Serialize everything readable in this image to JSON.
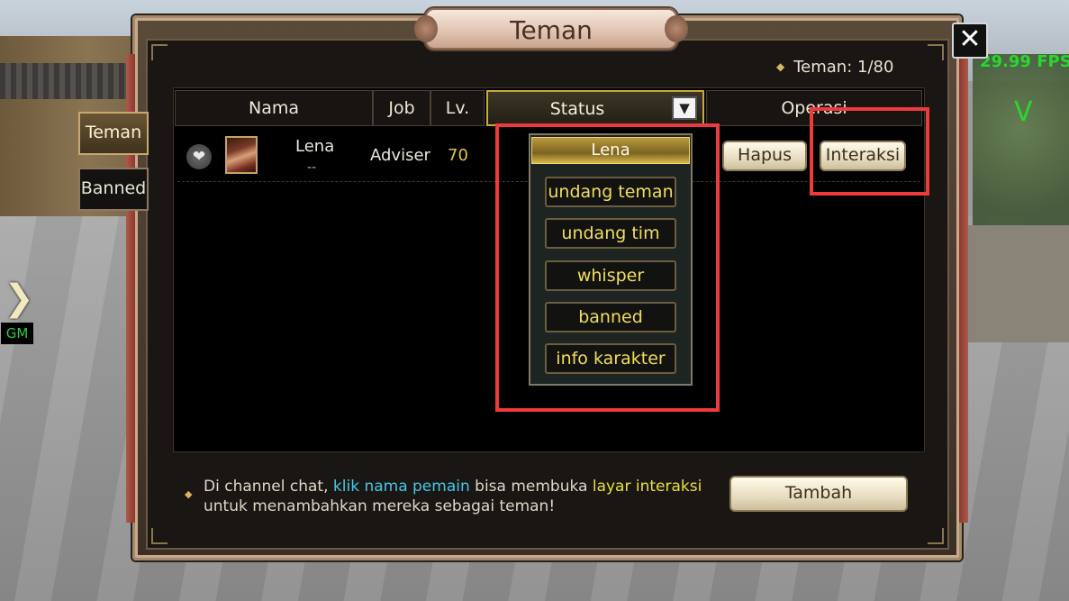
{
  "window": {
    "title": "Teman",
    "close_glyph": "✕"
  },
  "hud": {
    "fps": "29.99 FPS",
    "gm_label": "GM",
    "gm_arrow": "❯",
    "v_mark": "V"
  },
  "counter": {
    "label": "Teman: 1/80"
  },
  "side_tabs": [
    {
      "label": "Teman",
      "active": true
    },
    {
      "label": "Banned",
      "active": false
    }
  ],
  "table": {
    "headers": {
      "name": "Nama",
      "job": "Job",
      "level": "Lv.",
      "status": "Status",
      "operation": "Operasi"
    },
    "dropdown_glyph": "▼",
    "row": {
      "heart_glyph": "❤",
      "name": "Lena",
      "name_sub": "--",
      "job": "Adviser",
      "level": "70",
      "buttons": {
        "delete": "Hapus",
        "interact": "Interaksi"
      }
    }
  },
  "menu": {
    "title": "Lena",
    "items": [
      "undang teman",
      "undang tim",
      "whisper",
      "banned",
      "info karakter"
    ]
  },
  "footer": {
    "hint_part1": "Di channel chat, ",
    "hint_link1": "klik nama pemain",
    "hint_part2": " bisa membuka ",
    "hint_link2": "layar interaksi",
    "hint_line2": "untuk menambahkan mereka sebagai teman!",
    "add_button": "Tambah"
  },
  "colors": {
    "highlight": "#ee3a3a",
    "accent_gold": "#e4c44a",
    "link_cyan": "#44c8e8",
    "link_yellow": "#e8e03a",
    "fps_green": "#28d82e"
  }
}
